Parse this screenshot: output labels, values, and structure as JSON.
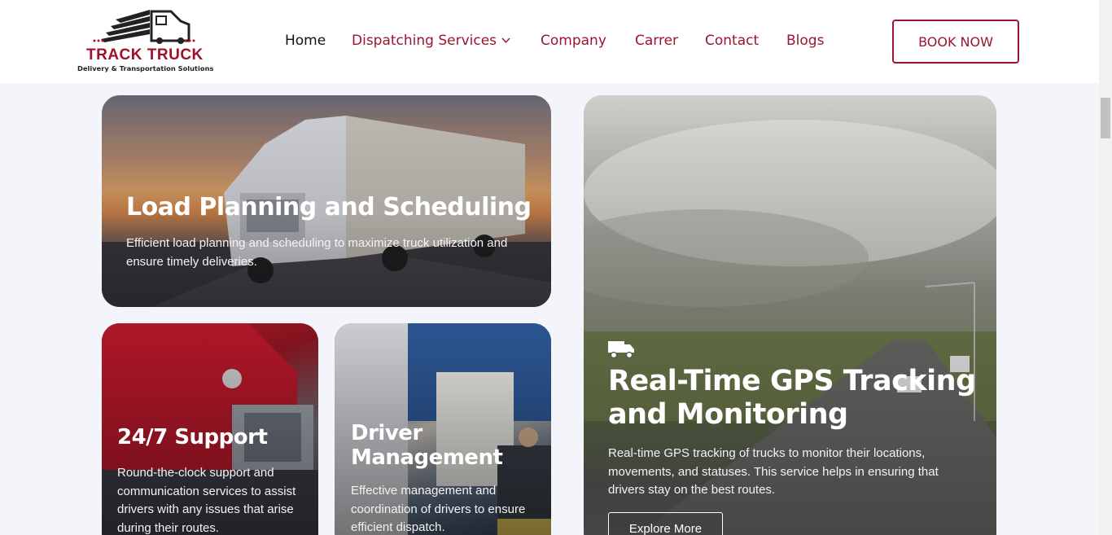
{
  "brand": {
    "name": "TRACK TRUCK",
    "tagline": "Delivery & Transportation Solutions",
    "color": "#a0102a"
  },
  "nav": {
    "items": [
      {
        "label": "Home",
        "active": true
      },
      {
        "label": "Dispatching Services",
        "has_dropdown": true
      },
      {
        "label": "Company"
      },
      {
        "label": "Carrer"
      },
      {
        "label": "Contact"
      },
      {
        "label": "Blogs"
      }
    ],
    "cta_label": "BOOK NOW"
  },
  "cards": {
    "load": {
      "title": "Load Planning and Scheduling",
      "text": "Efficient load planning and scheduling to maximize truck utilization and ensure timely deliveries."
    },
    "support": {
      "title": "24/7 Support",
      "text": "Round-the-clock support and communication services to assist drivers with any issues that arise during their routes."
    },
    "driver": {
      "title": "Driver Management",
      "text": "Effective management and coordination of drivers to ensure efficient dispatch."
    },
    "gps": {
      "icon": "truck-icon",
      "title": "Real-Time GPS Tracking and Monitoring",
      "text": "Real-time GPS tracking of trucks to monitor their locations, movements, and statuses. This service helps in ensuring that drivers stay on the best routes.",
      "button_label": "Explore More"
    }
  },
  "colors": {
    "accent": "#9b1530",
    "page_bg": "#f3f5fa"
  }
}
